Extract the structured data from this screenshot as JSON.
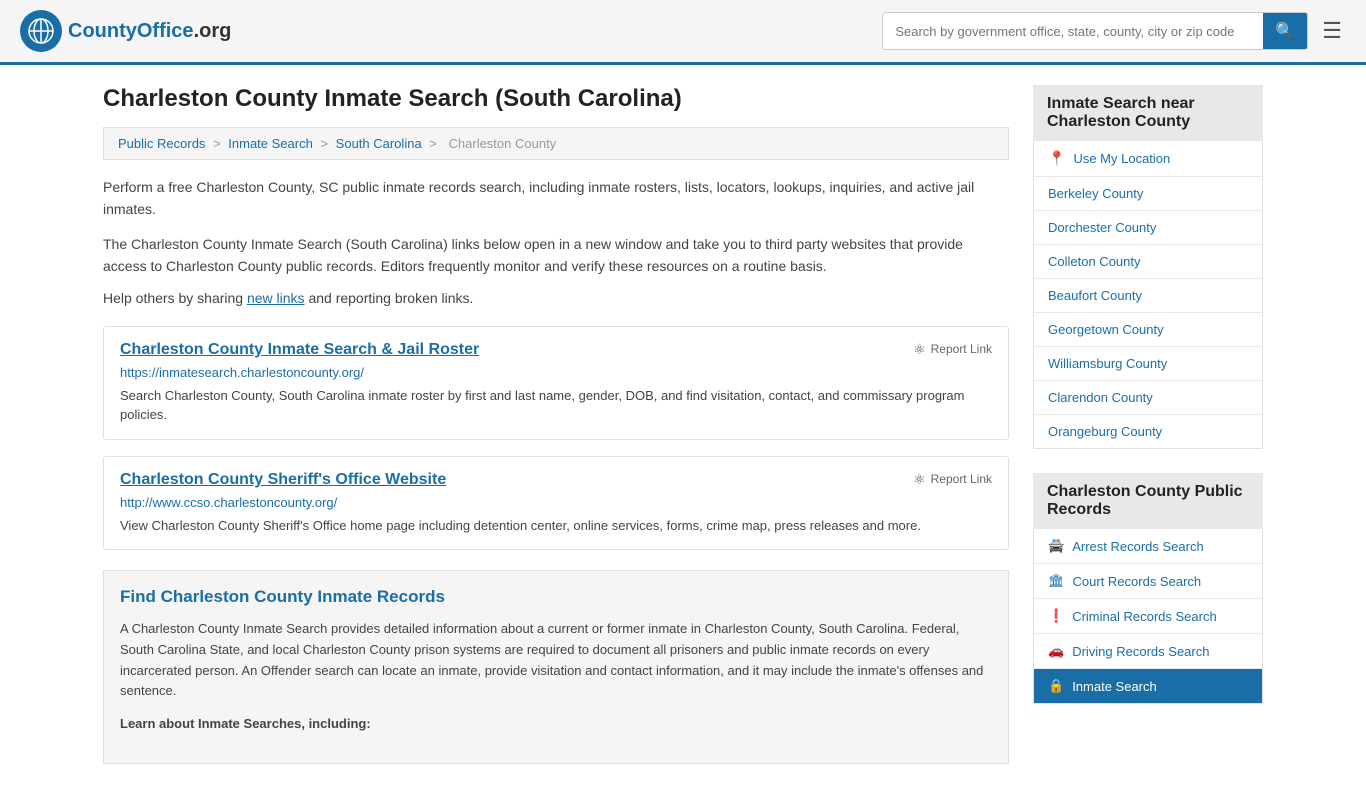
{
  "header": {
    "logo_text": "CountyOffice",
    "logo_suffix": ".org",
    "search_placeholder": "Search by government office, state, county, city or zip code"
  },
  "page": {
    "title": "Charleston County Inmate Search (South Carolina)"
  },
  "breadcrumb": {
    "items": [
      "Public Records",
      "Inmate Search",
      "South Carolina",
      "Charleston County"
    ]
  },
  "main_content": {
    "intro1": "Perform a free Charleston County, SC public inmate records search, including inmate rosters, lists, locators, lookups, inquiries, and active jail inmates.",
    "intro2": "The Charleston County Inmate Search (South Carolina) links below open in a new window and take you to third party websites that provide access to Charleston County public records. Editors frequently monitor and verify these resources on a routine basis.",
    "sharing_note_prefix": "Help others by sharing ",
    "sharing_link_text": "new links",
    "sharing_note_suffix": " and reporting broken links.",
    "results": [
      {
        "title": "Charleston County Inmate Search & Jail Roster",
        "url": "https://inmatesearch.charlestoncounty.org/",
        "description": "Search Charleston County, South Carolina inmate roster by first and last name, gender, DOB, and find visitation, contact, and commissary program policies.",
        "report_label": "Report Link"
      },
      {
        "title": "Charleston County Sheriff's Office Website",
        "url": "http://www.ccso.charlestoncounty.org/",
        "description": "View Charleston County Sheriff's Office home page including detention center, online services, forms, crime map, press releases and more.",
        "report_label": "Report Link"
      }
    ],
    "find_section": {
      "heading": "Find Charleston County Inmate Records",
      "para1": "A Charleston County Inmate Search provides detailed information about a current or former inmate in Charleston County, South Carolina. Federal, South Carolina State, and local Charleston County prison systems are required to document all prisoners and public inmate records on every incarcerated person. An Offender search can locate an inmate, provide visitation and contact information, and it may include the inmate's offenses and sentence.",
      "learn_heading": "Learn about Inmate Searches, including:"
    }
  },
  "sidebar": {
    "nearby_header": "Inmate Search near Charleston County",
    "location_label": "Use My Location",
    "nearby_counties": [
      "Berkeley County",
      "Dorchester County",
      "Colleton County",
      "Beaufort County",
      "Georgetown County",
      "Williamsburg County",
      "Clarendon County",
      "Orangeburg County"
    ],
    "public_records_header": "Charleston County Public Records",
    "public_records": [
      {
        "label": "Arrest Records Search",
        "icon": "🚔",
        "active": false
      },
      {
        "label": "Court Records Search",
        "icon": "🏛",
        "active": false
      },
      {
        "label": "Criminal Records Search",
        "icon": "❗",
        "active": false
      },
      {
        "label": "Driving Records Search",
        "icon": "🚗",
        "active": false
      },
      {
        "label": "Inmate Search",
        "icon": "🔒",
        "active": true
      }
    ]
  }
}
